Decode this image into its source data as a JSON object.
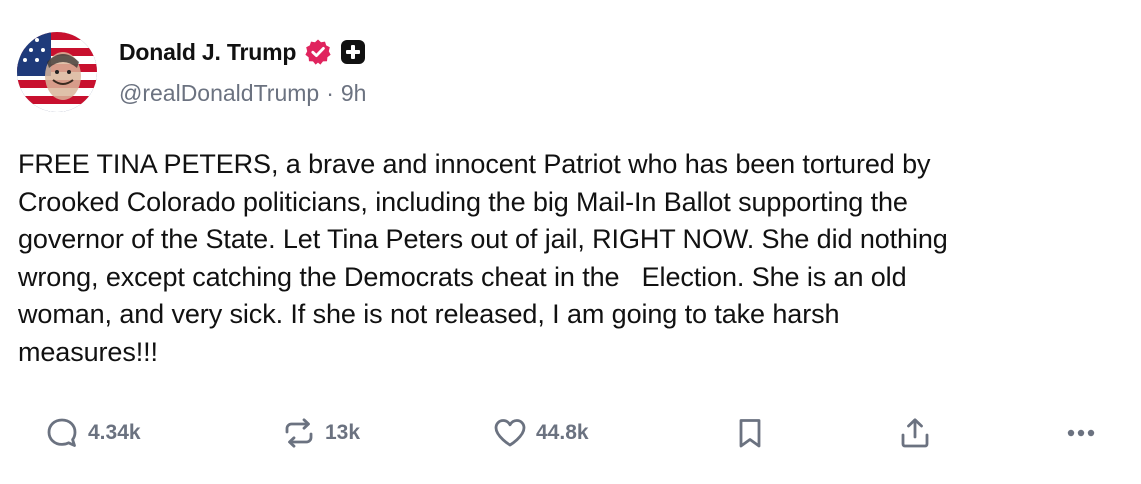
{
  "author": {
    "display_name": "Donald J. Trump",
    "handle": "@realDonaldTrump",
    "separator": "·",
    "time_ago": "9h",
    "verified_color": "#e0245e",
    "icons": [
      "verified-badge-icon",
      "plus-badge-icon"
    ]
  },
  "post": {
    "text": "FREE TINA PETERS, a brave and innocent Patriot who has been tortured by\nCrooked Colorado politicians, including the big Mail-In Ballot supporting the\ngovernor of the State. Let Tina Peters out of jail, RIGHT NOW. She did nothing\nwrong, except catching the Democrats cheat in the   Election. She is an old\nwoman, and very sick. If she is not released, I am going to take harsh\nmeasures!!!"
  },
  "actions": {
    "reply": {
      "icon": "reply-icon",
      "count": "4.34k"
    },
    "repost": {
      "icon": "repost-icon",
      "count": "13k"
    },
    "like": {
      "icon": "heart-icon",
      "count": "44.8k"
    },
    "bookmark": {
      "icon": "bookmark-icon"
    },
    "share": {
      "icon": "share-icon"
    },
    "more": {
      "icon": "more-icon"
    }
  },
  "colors": {
    "text": "#111111",
    "muted": "#6b7280",
    "background": "#ffffff"
  }
}
